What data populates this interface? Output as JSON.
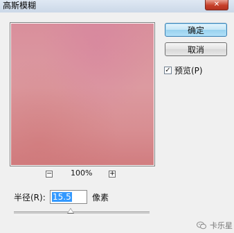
{
  "window": {
    "title": "高斯模糊",
    "close_glyph": "✕"
  },
  "buttons": {
    "ok_label": "确定",
    "cancel_label": "取消"
  },
  "preview": {
    "checkbox_label": "预览(P)",
    "checked": true,
    "check_glyph": "✓"
  },
  "zoom": {
    "minus_glyph": "−",
    "plus_glyph": "+",
    "level": "100%"
  },
  "radius": {
    "label": "半径(R):",
    "value": "15.5",
    "unit": "像素",
    "slider_fraction": 0.42
  },
  "watermark": {
    "icon": "wechat-icon",
    "text": "卡乐星"
  },
  "colors": {
    "preview_tint": "#d98f9c",
    "selection": "#3399ff"
  }
}
